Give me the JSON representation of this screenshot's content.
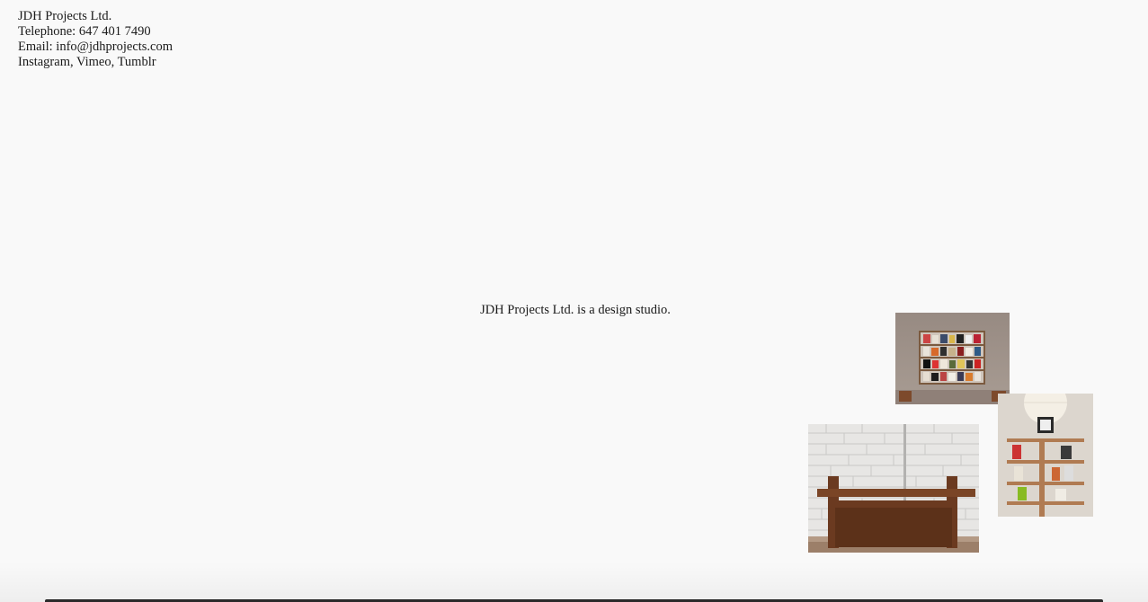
{
  "contact": {
    "company": "JDH Projects Ltd.",
    "telephone": "Telephone: 647 401 7490",
    "email_prefix": "Email: ",
    "email": "info@jdhprojects.com",
    "social": {
      "instagram": "Instagram",
      "sep1": ", ",
      "vimeo": "Vimeo",
      "sep2": ", ",
      "tumblr": "Tumblr"
    }
  },
  "tagline": "JDH Projects Ltd. is a design studio.",
  "colors": {
    "background": "#f9f9f9",
    "text": "#1a1a1a"
  }
}
